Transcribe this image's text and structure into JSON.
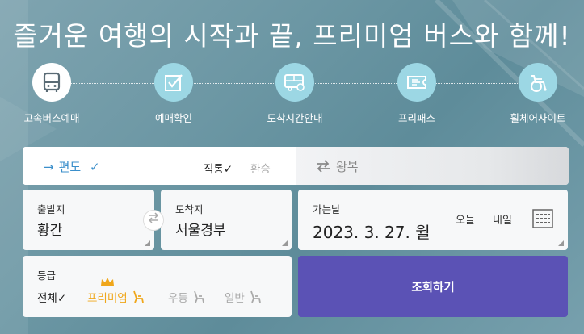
{
  "headline": "즐거운 여행의 시작과 끝, 프리미엄 버스와 함께!",
  "nav": [
    {
      "label": "고속버스예매",
      "icon": "bus-icon",
      "active": true
    },
    {
      "label": "예매확인",
      "icon": "checkbox-icon",
      "active": false
    },
    {
      "label": "도착시간안내",
      "icon": "bus-time-icon",
      "active": false
    },
    {
      "label": "프리패스",
      "icon": "ticket-icon",
      "active": false
    },
    {
      "label": "휠체어사이트",
      "icon": "wheelchair-icon",
      "active": false
    }
  ],
  "trip": {
    "oneway_label": "편도",
    "oneway_arrow": "→",
    "oneway_check": "✓",
    "direct_label": "직통✓",
    "transfer_label": "환승",
    "roundtrip_label": "왕복"
  },
  "departure": {
    "label": "출발지",
    "value": "황간"
  },
  "arrival": {
    "label": "도착지",
    "value": "서울경부"
  },
  "date": {
    "label": "가는날",
    "value": "2023. 3. 27. 월",
    "today": "오늘",
    "tomorrow": "내일"
  },
  "grade": {
    "label": "등급",
    "options": [
      {
        "label": "전체✓",
        "selected": true
      },
      {
        "label": "프리미엄",
        "selected": false
      },
      {
        "label": "우등",
        "selected": false
      },
      {
        "label": "일반",
        "selected": false
      }
    ]
  },
  "search_button": "조회하기",
  "colors": {
    "accent_blue": "#3b8fcb",
    "premium_gold": "#f0a71b",
    "search_purple": "#5b52b5",
    "nav_circle": "#9cd7e4"
  }
}
